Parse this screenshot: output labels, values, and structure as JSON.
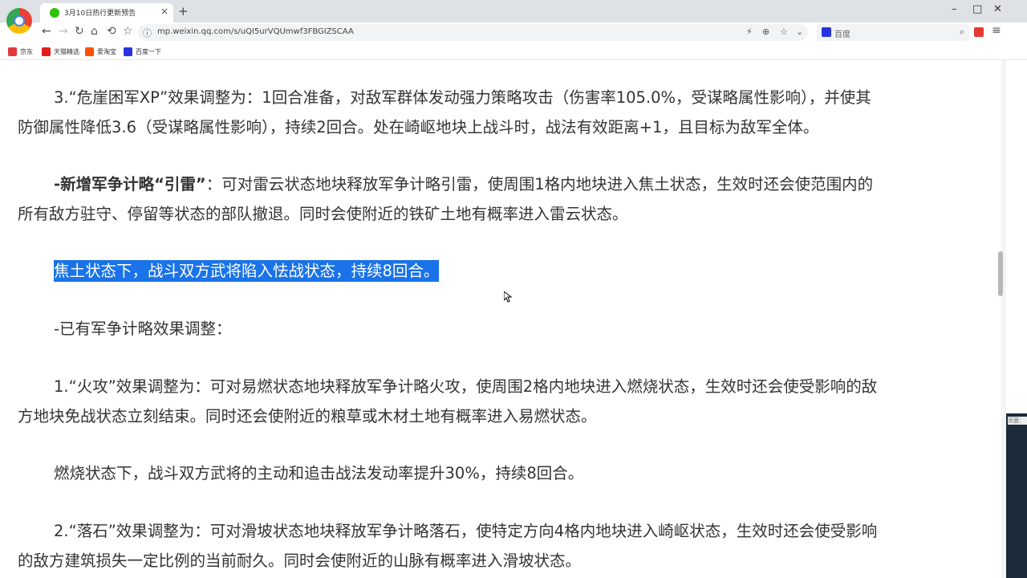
{
  "browser": {
    "tab_title": "3月10日热行更新预告",
    "tab_close": "×",
    "new_tab": "+",
    "url": "mp.weixin.qq.com/s/uQI5urVQUmwf3FBGIZSCAA",
    "search_placeholder": "百度",
    "window_controls": [
      "–",
      "□",
      "✕"
    ],
    "nav": [
      "←",
      "→",
      "↻",
      "⌂",
      "⟲",
      "☆"
    ]
  },
  "bookmarks": [
    {
      "label": "京东",
      "color": "#e4393c"
    },
    {
      "label": "天猫精选",
      "color": "#e21b1b"
    },
    {
      "label": "爱淘宝",
      "color": "#ff5000"
    },
    {
      "label": "百度一下",
      "color": "#2932e1"
    }
  ],
  "article": {
    "p1_l1": "3.“危崖困军XP”效果调整为：1回合准备，对敌军群体发动强力策略攻击（伤害率105.0%，受谋略属性影响），并使其",
    "p1_l2": "防御属性降低3.6（受谋略属性影响），持续2回合。处在崎岖地块上战斗时，战法有效距离+1，且目标为敌军全体。",
    "p2_bold": "-新增军争计略“引雷”",
    "p2_l1": "：可对雷云状态地块释放军争计略引雷，使周围1格内地块进入焦土状态，生效时还会使范围内的",
    "p2_l2": "所有敌方驻守、停留等状态的部队撤退。同时会使附近的铁矿土地有概率进入雷云状态。",
    "p3_selected": "焦土状态下，战斗双方武将陷入怯战状态，持续8回合。",
    "p4": "-已有军争计略效果调整：",
    "p5_l1": "1.“火攻”效果调整为：可对易燃状态地块释放军争计略火攻，使周围2格内地块进入燃烧状态，生效时还会使受影响的敌",
    "p5_l2": "方地块免战状态立刻结束。同时还会使附近的粮草或木材土地有概率进入易燃状态。",
    "p6": "燃烧状态下，战斗双方武将的主动和追击战法发动率提升30%，持续8回合。",
    "p7_l1": "2.“落石”效果调整为：可对滑坡状态地块释放军争计略落石，使特定方向4格内地块进入崎岖状态，生效时还会使受影响",
    "p7_l2": "的敌方建筑损失一定比例的当前耐久。同时会使附近的山脉有概率进入滑坡状态。"
  },
  "side_label": "页面："
}
